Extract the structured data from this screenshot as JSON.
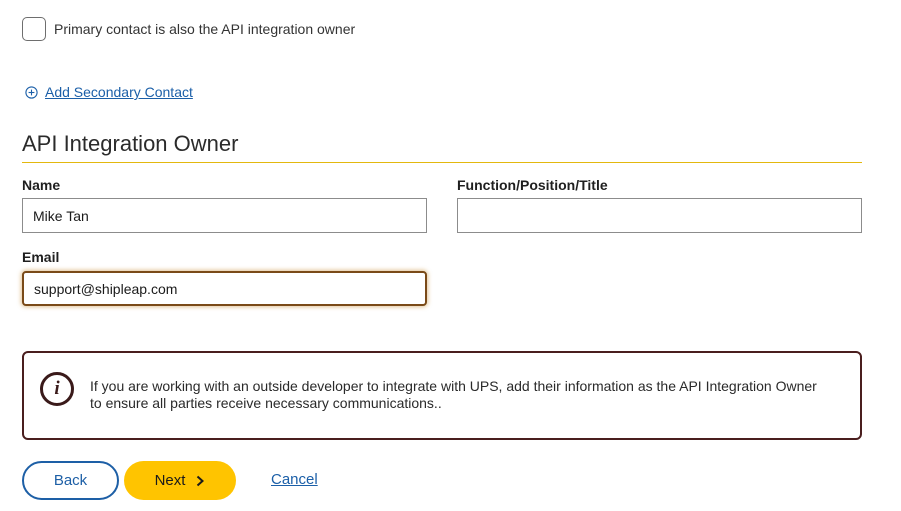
{
  "primary_contact": {
    "checkbox_label": "Primary contact is also the API integration owner",
    "checked": false
  },
  "add_secondary_contact": {
    "label": " Add Secondary Contact",
    "icon": "plus-circle-icon"
  },
  "section": {
    "title": "API Integration Owner",
    "rule_color": "#e3b80e"
  },
  "form": {
    "name": {
      "label": "Name",
      "value": "Mike Tan"
    },
    "function": {
      "label": "Function/Position/Title",
      "value": ""
    },
    "email": {
      "label": "Email",
      "value": "support@shipleap.com"
    }
  },
  "info": {
    "icon": "info-icon",
    "glyph": "i",
    "text": "If you are working with an outside developer to integrate with UPS, add their information as the API Integration Owner to ensure all parties receive necessary communications.."
  },
  "actions": {
    "back_label": "Back",
    "next_label": "Next",
    "next_icon": "chevron-right-icon",
    "cancel_label": "Cancel"
  },
  "colors": {
    "link": "#1b5fa8",
    "primary_button": "#ffc400",
    "info_border": "#4a1e1e",
    "focus_border": "#7a4a18"
  }
}
